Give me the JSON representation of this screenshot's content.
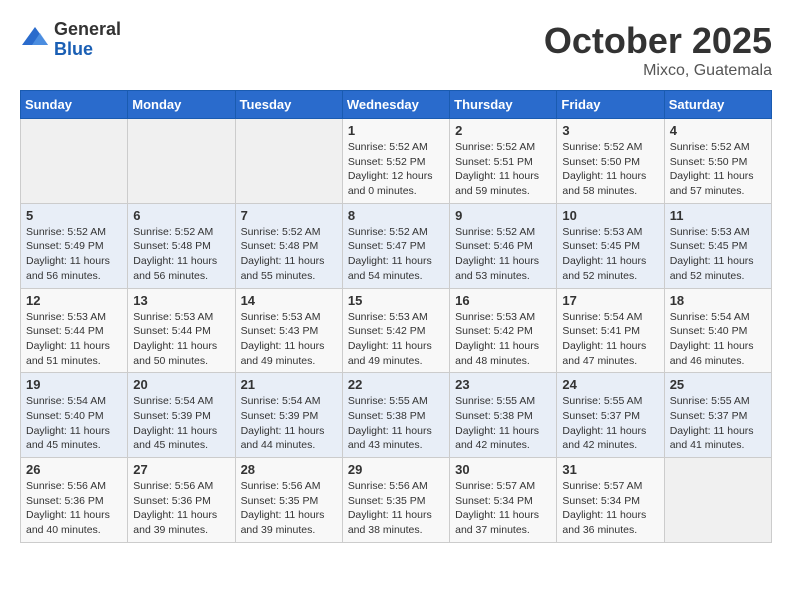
{
  "header": {
    "logo": {
      "general": "General",
      "blue": "Blue"
    },
    "title": "October 2025",
    "location": "Mixco, Guatemala"
  },
  "weekdays": [
    "Sunday",
    "Monday",
    "Tuesday",
    "Wednesday",
    "Thursday",
    "Friday",
    "Saturday"
  ],
  "weeks": [
    [
      {
        "day": "",
        "sunrise": "",
        "sunset": "",
        "daylight": ""
      },
      {
        "day": "",
        "sunrise": "",
        "sunset": "",
        "daylight": ""
      },
      {
        "day": "",
        "sunrise": "",
        "sunset": "",
        "daylight": ""
      },
      {
        "day": "1",
        "sunrise": "Sunrise: 5:52 AM",
        "sunset": "Sunset: 5:52 PM",
        "daylight": "Daylight: 12 hours and 0 minutes."
      },
      {
        "day": "2",
        "sunrise": "Sunrise: 5:52 AM",
        "sunset": "Sunset: 5:51 PM",
        "daylight": "Daylight: 11 hours and 59 minutes."
      },
      {
        "day": "3",
        "sunrise": "Sunrise: 5:52 AM",
        "sunset": "Sunset: 5:50 PM",
        "daylight": "Daylight: 11 hours and 58 minutes."
      },
      {
        "day": "4",
        "sunrise": "Sunrise: 5:52 AM",
        "sunset": "Sunset: 5:50 PM",
        "daylight": "Daylight: 11 hours and 57 minutes."
      }
    ],
    [
      {
        "day": "5",
        "sunrise": "Sunrise: 5:52 AM",
        "sunset": "Sunset: 5:49 PM",
        "daylight": "Daylight: 11 hours and 56 minutes."
      },
      {
        "day": "6",
        "sunrise": "Sunrise: 5:52 AM",
        "sunset": "Sunset: 5:48 PM",
        "daylight": "Daylight: 11 hours and 56 minutes."
      },
      {
        "day": "7",
        "sunrise": "Sunrise: 5:52 AM",
        "sunset": "Sunset: 5:48 PM",
        "daylight": "Daylight: 11 hours and 55 minutes."
      },
      {
        "day": "8",
        "sunrise": "Sunrise: 5:52 AM",
        "sunset": "Sunset: 5:47 PM",
        "daylight": "Daylight: 11 hours and 54 minutes."
      },
      {
        "day": "9",
        "sunrise": "Sunrise: 5:52 AM",
        "sunset": "Sunset: 5:46 PM",
        "daylight": "Daylight: 11 hours and 53 minutes."
      },
      {
        "day": "10",
        "sunrise": "Sunrise: 5:53 AM",
        "sunset": "Sunset: 5:45 PM",
        "daylight": "Daylight: 11 hours and 52 minutes."
      },
      {
        "day": "11",
        "sunrise": "Sunrise: 5:53 AM",
        "sunset": "Sunset: 5:45 PM",
        "daylight": "Daylight: 11 hours and 52 minutes."
      }
    ],
    [
      {
        "day": "12",
        "sunrise": "Sunrise: 5:53 AM",
        "sunset": "Sunset: 5:44 PM",
        "daylight": "Daylight: 11 hours and 51 minutes."
      },
      {
        "day": "13",
        "sunrise": "Sunrise: 5:53 AM",
        "sunset": "Sunset: 5:44 PM",
        "daylight": "Daylight: 11 hours and 50 minutes."
      },
      {
        "day": "14",
        "sunrise": "Sunrise: 5:53 AM",
        "sunset": "Sunset: 5:43 PM",
        "daylight": "Daylight: 11 hours and 49 minutes."
      },
      {
        "day": "15",
        "sunrise": "Sunrise: 5:53 AM",
        "sunset": "Sunset: 5:42 PM",
        "daylight": "Daylight: 11 hours and 49 minutes."
      },
      {
        "day": "16",
        "sunrise": "Sunrise: 5:53 AM",
        "sunset": "Sunset: 5:42 PM",
        "daylight": "Daylight: 11 hours and 48 minutes."
      },
      {
        "day": "17",
        "sunrise": "Sunrise: 5:54 AM",
        "sunset": "Sunset: 5:41 PM",
        "daylight": "Daylight: 11 hours and 47 minutes."
      },
      {
        "day": "18",
        "sunrise": "Sunrise: 5:54 AM",
        "sunset": "Sunset: 5:40 PM",
        "daylight": "Daylight: 11 hours and 46 minutes."
      }
    ],
    [
      {
        "day": "19",
        "sunrise": "Sunrise: 5:54 AM",
        "sunset": "Sunset: 5:40 PM",
        "daylight": "Daylight: 11 hours and 45 minutes."
      },
      {
        "day": "20",
        "sunrise": "Sunrise: 5:54 AM",
        "sunset": "Sunset: 5:39 PM",
        "daylight": "Daylight: 11 hours and 45 minutes."
      },
      {
        "day": "21",
        "sunrise": "Sunrise: 5:54 AM",
        "sunset": "Sunset: 5:39 PM",
        "daylight": "Daylight: 11 hours and 44 minutes."
      },
      {
        "day": "22",
        "sunrise": "Sunrise: 5:55 AM",
        "sunset": "Sunset: 5:38 PM",
        "daylight": "Daylight: 11 hours and 43 minutes."
      },
      {
        "day": "23",
        "sunrise": "Sunrise: 5:55 AM",
        "sunset": "Sunset: 5:38 PM",
        "daylight": "Daylight: 11 hours and 42 minutes."
      },
      {
        "day": "24",
        "sunrise": "Sunrise: 5:55 AM",
        "sunset": "Sunset: 5:37 PM",
        "daylight": "Daylight: 11 hours and 42 minutes."
      },
      {
        "day": "25",
        "sunrise": "Sunrise: 5:55 AM",
        "sunset": "Sunset: 5:37 PM",
        "daylight": "Daylight: 11 hours and 41 minutes."
      }
    ],
    [
      {
        "day": "26",
        "sunrise": "Sunrise: 5:56 AM",
        "sunset": "Sunset: 5:36 PM",
        "daylight": "Daylight: 11 hours and 40 minutes."
      },
      {
        "day": "27",
        "sunrise": "Sunrise: 5:56 AM",
        "sunset": "Sunset: 5:36 PM",
        "daylight": "Daylight: 11 hours and 39 minutes."
      },
      {
        "day": "28",
        "sunrise": "Sunrise: 5:56 AM",
        "sunset": "Sunset: 5:35 PM",
        "daylight": "Daylight: 11 hours and 39 minutes."
      },
      {
        "day": "29",
        "sunrise": "Sunrise: 5:56 AM",
        "sunset": "Sunset: 5:35 PM",
        "daylight": "Daylight: 11 hours and 38 minutes."
      },
      {
        "day": "30",
        "sunrise": "Sunrise: 5:57 AM",
        "sunset": "Sunset: 5:34 PM",
        "daylight": "Daylight: 11 hours and 37 minutes."
      },
      {
        "day": "31",
        "sunrise": "Sunrise: 5:57 AM",
        "sunset": "Sunset: 5:34 PM",
        "daylight": "Daylight: 11 hours and 36 minutes."
      },
      {
        "day": "",
        "sunrise": "",
        "sunset": "",
        "daylight": ""
      }
    ]
  ]
}
